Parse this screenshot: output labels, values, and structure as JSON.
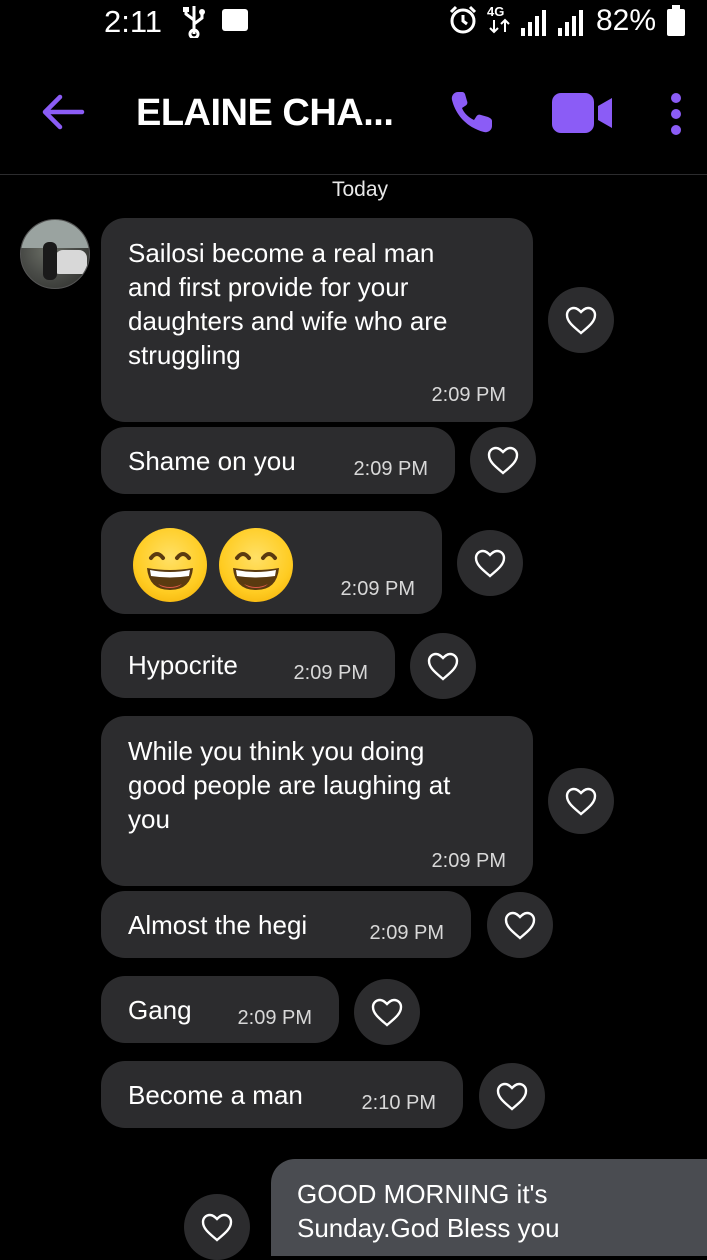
{
  "status_bar": {
    "time": "2:11",
    "network": "4G",
    "battery_percent": "82%"
  },
  "header": {
    "title": "ELAINE CHA...",
    "accent_color": "#8b5cf6"
  },
  "date_separator": "Today",
  "messages": [
    {
      "text": "Sailosi become a real man and first provide for your daughters and wife who are struggling",
      "lines": [
        "Sailosi become a real man",
        "and first provide for your",
        "daughters and wife who are",
        "struggling"
      ],
      "time": "2:09 PM",
      "direction": "incoming"
    },
    {
      "text": "Shame on you",
      "time": "2:09 PM",
      "direction": "incoming"
    },
    {
      "text": "😄😄",
      "time": "2:09 PM",
      "direction": "incoming"
    },
    {
      "text": "Hypocrite",
      "time": "2:09 PM",
      "direction": "incoming"
    },
    {
      "text": "While you think you doing good people are laughing at you",
      "lines": [
        "While you think you doing",
        "good people are laughing at",
        "you"
      ],
      "time": "2:09 PM",
      "direction": "incoming"
    },
    {
      "text": "Almost the hegi",
      "time": "2:09 PM",
      "direction": "incoming"
    },
    {
      "text": "Gang",
      "time": "2:09 PM",
      "direction": "incoming"
    },
    {
      "text": "Become a man",
      "time": "2:10 PM",
      "direction": "incoming"
    },
    {
      "text": "GOOD MORNING it's Sunday.God Bless you",
      "lines": [
        "GOOD MORNING it's",
        "Sunday.God Bless you"
      ],
      "direction": "outgoing"
    }
  ],
  "icons": {
    "back": "arrow-left-icon",
    "call": "phone-icon",
    "video": "video-camera-icon",
    "more": "more-vertical-icon",
    "react": "heart-outline-icon"
  }
}
